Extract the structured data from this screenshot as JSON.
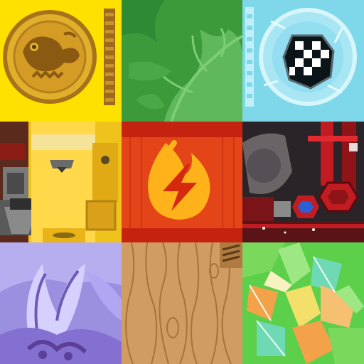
{
  "atlas": {
    "tiles": [
      {
        "id": "coin",
        "texture": "gold-coin-chameleon",
        "colors": {
          "bg": "#ffe100",
          "coin": "#e0b02c",
          "rim": "#a8721a",
          "stripe": "#9c6a1a"
        }
      },
      {
        "id": "leaf",
        "texture": "green-leaf-foliage",
        "colors": {
          "bg": "#3c9a3a",
          "leaf": "#5fb95c",
          "vein": "#7ccd74"
        }
      },
      {
        "id": "ice",
        "texture": "ice-block-checkered-gem",
        "colors": {
          "bg": "#7fd8ea",
          "ice": "#bff0fa",
          "gem_dark": "#0b1418",
          "gem_light": "#ffffff"
        }
      },
      {
        "id": "mech",
        "texture": "yellow-mech-plating",
        "colors": {
          "bg": "#f0c21c",
          "panel": "#ffd94a",
          "dark": "#4a4a4a",
          "red": "#8a1c14"
        }
      },
      {
        "id": "fire",
        "texture": "red-fire-emblem",
        "colors": {
          "bg": "#e34418",
          "band": "#c4230f",
          "flame": "#ffb21a",
          "bolt": "#d6280c"
        }
      },
      {
        "id": "machine",
        "texture": "red-machinery",
        "colors": {
          "bg": "#2a2428",
          "metal": "#6a6466",
          "red": "#c11c22",
          "gem": "#2b5fd6"
        }
      },
      {
        "id": "crystal",
        "texture": "purple-crystal-claw",
        "colors": {
          "bg": "#9b8fe0",
          "light": "#d6d0ff",
          "dark": "#5d3f9a"
        }
      },
      {
        "id": "wood",
        "texture": "wood-grain-plank",
        "colors": {
          "bg": "#d19c62",
          "grain": "#a9713c"
        }
      },
      {
        "id": "shards",
        "texture": "green-crystal-shards",
        "colors": {
          "bg": "#5cd04a",
          "teal": "#6fd9b6",
          "orange": "#f4a24a",
          "yellow": "#f3e06a"
        }
      }
    ]
  }
}
